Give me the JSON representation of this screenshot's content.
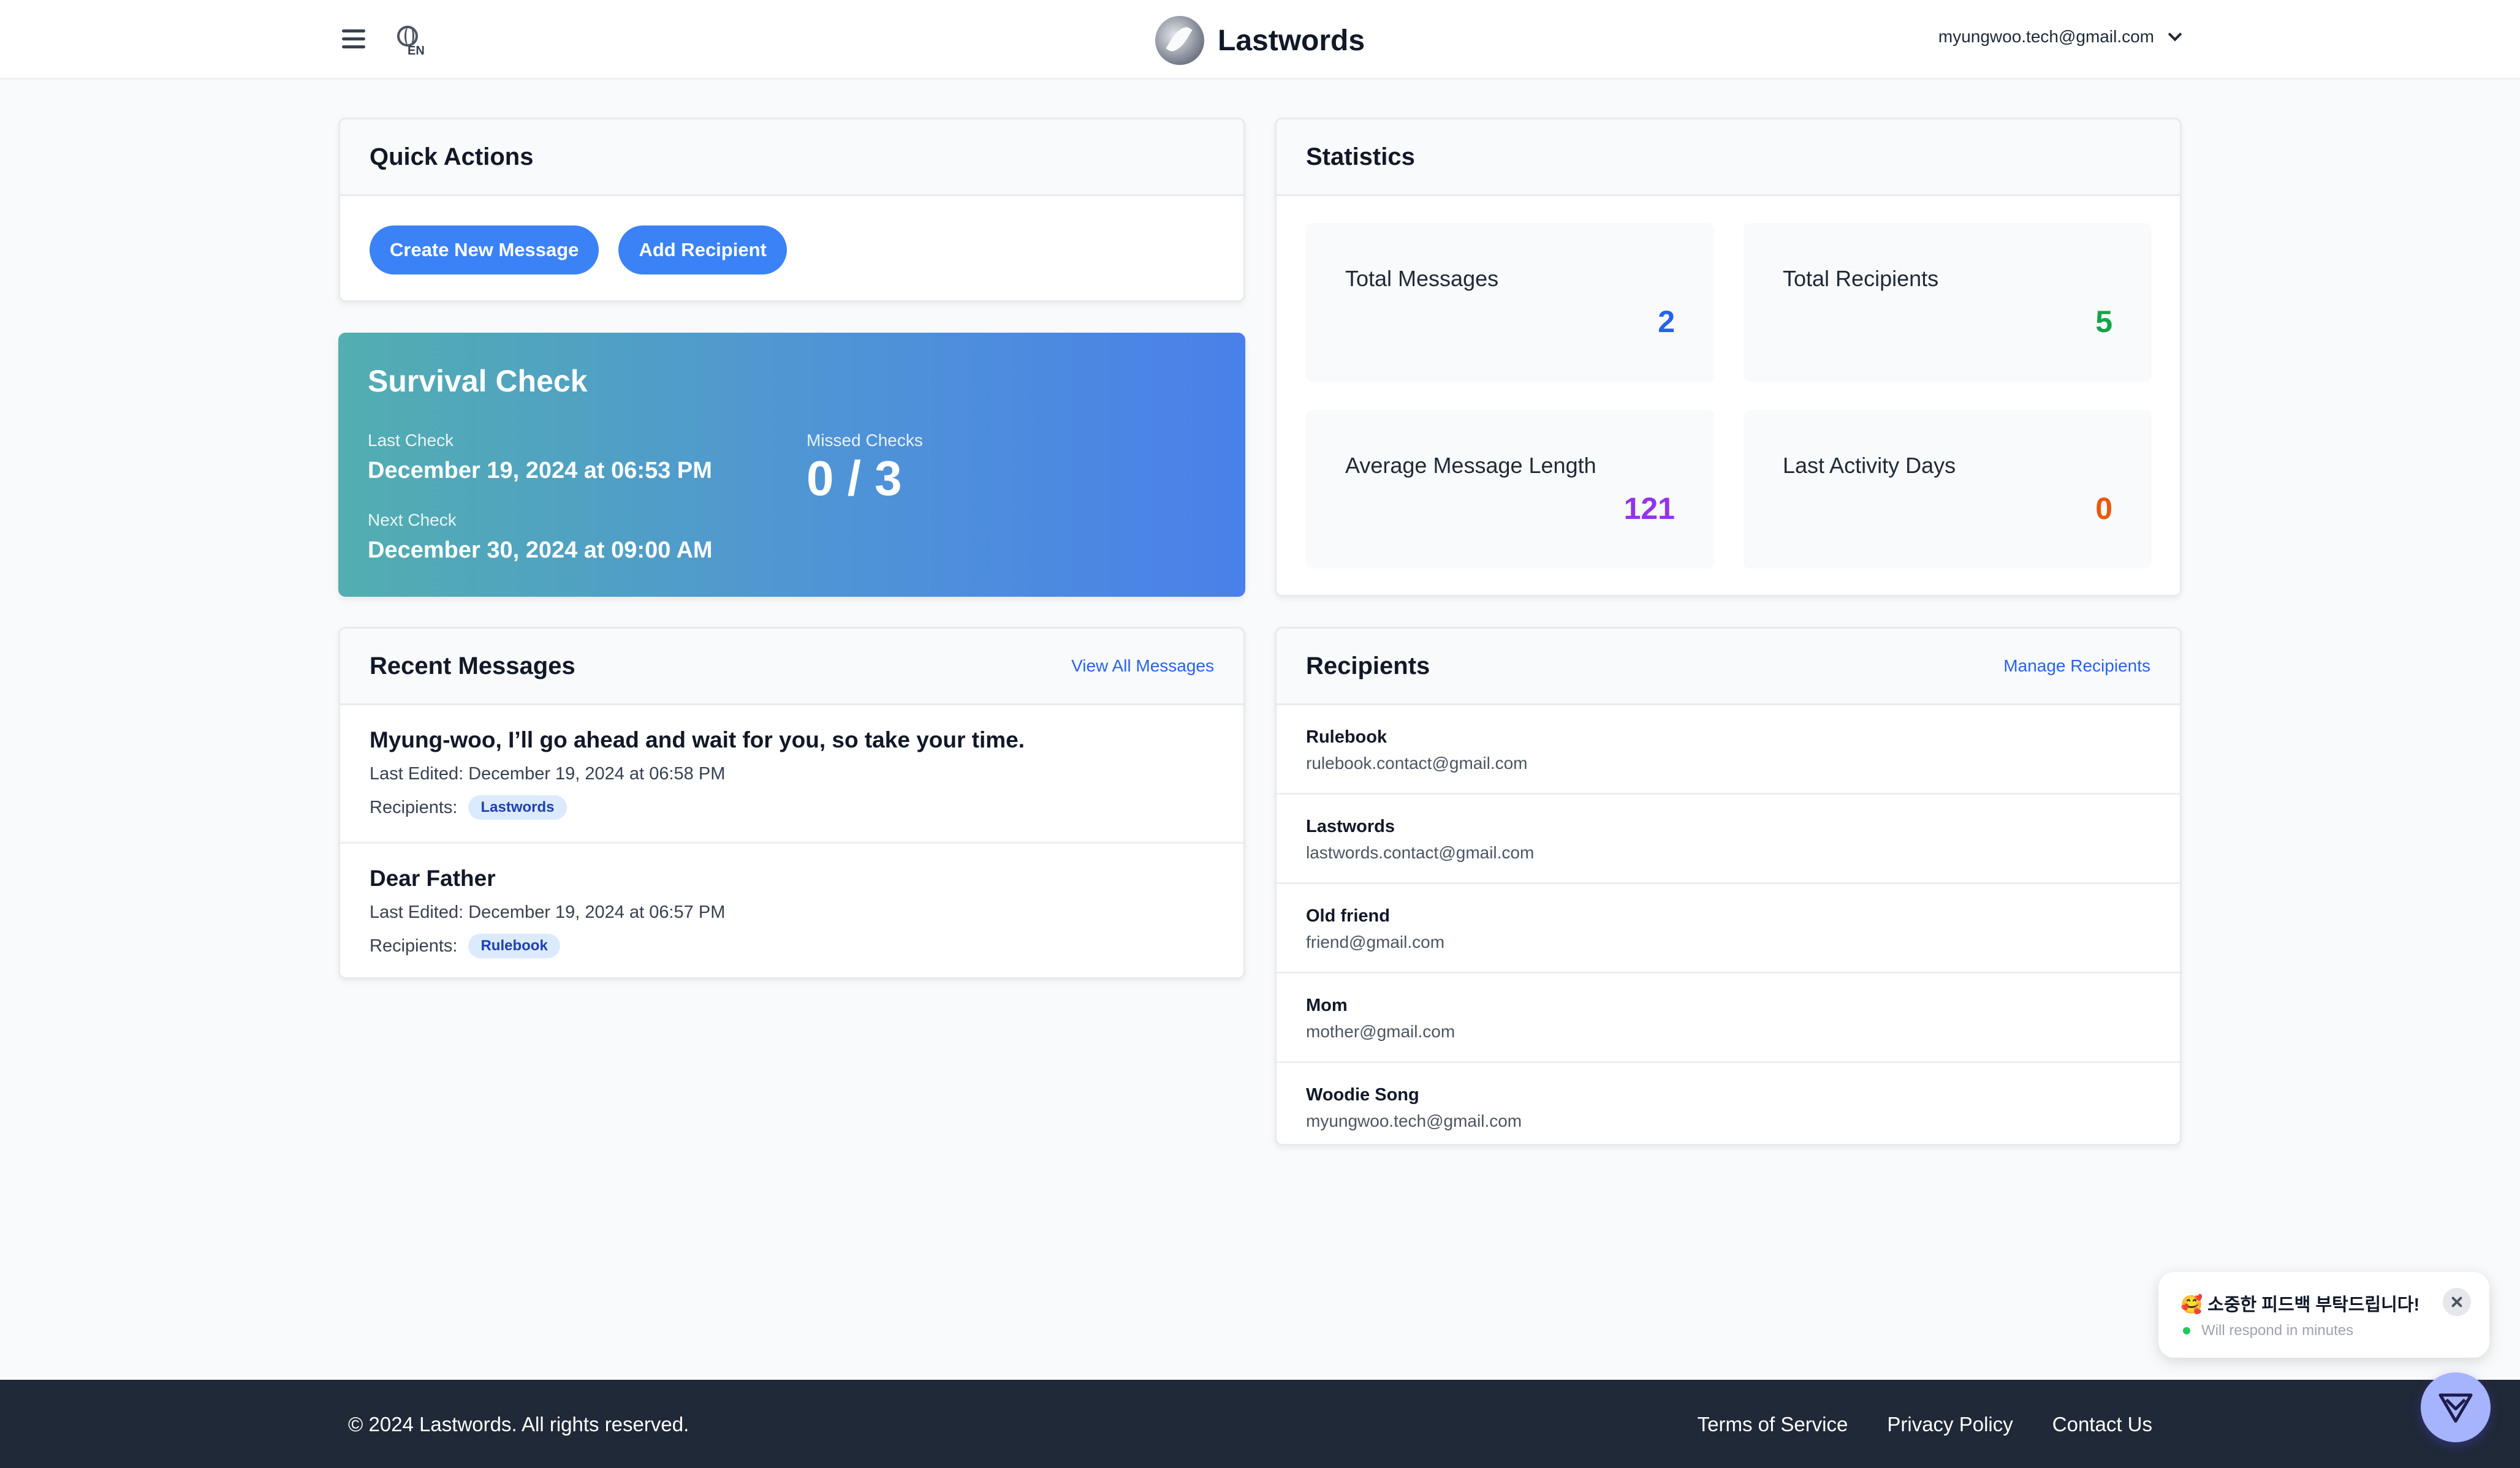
{
  "header": {
    "menu_icon": "hamburger-menu-icon",
    "language_icon": "globe-icon",
    "language_code": "EN",
    "brand_logo_icon": "feather-logo-icon",
    "brand_name": "Lastwords",
    "user_email": "myungwoo.tech@gmail.com",
    "user_menu_icon": "chevron-down-icon"
  },
  "quick_actions": {
    "title": "Quick Actions",
    "create_message_label": "Create New Message",
    "add_recipient_label": "Add Recipient"
  },
  "survival_check": {
    "title": "Survival Check",
    "last_check_label": "Last Check",
    "last_check_value": "December 19, 2024 at 06:53 PM",
    "next_check_label": "Next Check",
    "next_check_value": "December 30, 2024 at 09:00 AM",
    "missed_checks_label": "Missed Checks",
    "missed_checks_value": "0 / 3"
  },
  "statistics": {
    "title": "Statistics",
    "items": [
      {
        "label": "Total Messages",
        "value": "2",
        "color": "#2563eb"
      },
      {
        "label": "Total Recipients",
        "value": "5",
        "color": "#16a34a"
      },
      {
        "label": "Average Message Length",
        "value": "121",
        "color": "#9333ea"
      },
      {
        "label": "Last Activity Days",
        "value": "0",
        "color": "#ea580c"
      }
    ]
  },
  "recent_messages": {
    "title": "Recent Messages",
    "view_all_label": "View All Messages",
    "recipients_label": "Recipients:",
    "items": [
      {
        "title": "Myung-woo, I’ll go ahead and wait for you, so take your time.",
        "edited": "Last Edited: December 19, 2024 at 06:58 PM",
        "recipient": "Lastwords"
      },
      {
        "title": "Dear Father",
        "edited": "Last Edited: December 19, 2024 at 06:57 PM",
        "recipient": "Rulebook"
      }
    ]
  },
  "recipients": {
    "title": "Recipients",
    "manage_label": "Manage Recipients",
    "items": [
      {
        "name": "Rulebook",
        "email": "rulebook.contact@gmail.com"
      },
      {
        "name": "Lastwords",
        "email": "lastwords.contact@gmail.com"
      },
      {
        "name": "Old friend",
        "email": "friend@gmail.com"
      },
      {
        "name": "Mom",
        "email": "mother@gmail.com"
      },
      {
        "name": "Woodie Song",
        "email": "myungwoo.tech@gmail.com"
      }
    ]
  },
  "chat_widget": {
    "title": "🥰 소중한 피드백 부탁드립니다!",
    "status": "Will respond in minutes",
    "status_color": "#22c55e",
    "close_icon": "close-icon",
    "launcher_icon": "paper-plane-icon"
  },
  "footer": {
    "copyright": "© 2024 Lastwords. All rights reserved.",
    "links": [
      "Terms of Service",
      "Privacy Policy",
      "Contact Us"
    ]
  },
  "colors": {
    "accent": "#3b82f6",
    "link": "#2563eb",
    "footer_bg": "#1f2937",
    "survival_gradient_start": "#52aeb0",
    "survival_gradient_end": "#4a80ea"
  }
}
